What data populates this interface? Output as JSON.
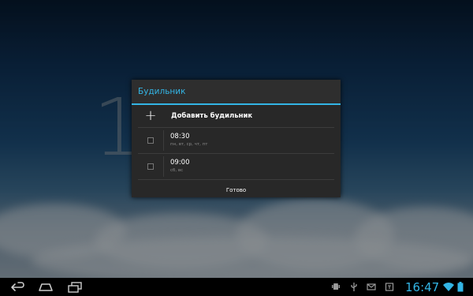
{
  "dialog": {
    "title": "Будильник",
    "add_label": "Добавить будильник",
    "alarms": [
      {
        "time": "08:30",
        "days": "пн, вт, ср, чт, пт"
      },
      {
        "time": "09:00",
        "days": "сб, вс"
      }
    ],
    "done_label": "Готово"
  },
  "background": {
    "clock_digit": "1"
  },
  "status_bar": {
    "time": "16:47",
    "icons": [
      "android-debug-icon",
      "usb-icon",
      "gmail-icon",
      "calendar-icon",
      "wifi-icon",
      "battery-icon"
    ]
  },
  "nav_bar": {
    "buttons": [
      "back-icon",
      "home-icon",
      "recent-apps-icon"
    ]
  },
  "colors": {
    "accent": "#33b5e5",
    "dialog_bg": "#282828",
    "nav_bg": "#000000"
  }
}
